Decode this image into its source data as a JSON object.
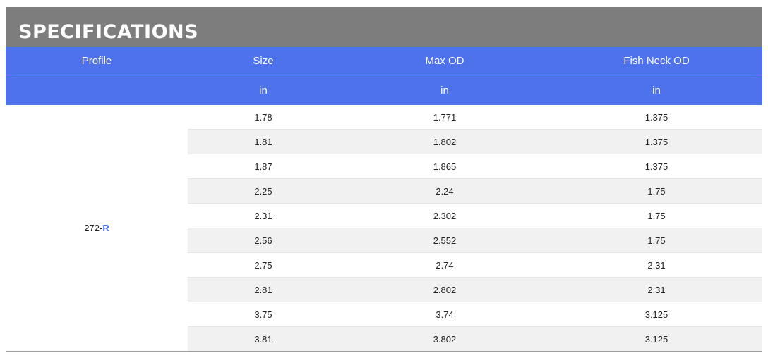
{
  "section": {
    "title": "SPECIFICATIONS"
  },
  "columns": [
    "Profile",
    "Size",
    "Max OD",
    "Fish Neck OD"
  ],
  "units": [
    "",
    "in",
    "in",
    "in"
  ],
  "profile": {
    "prefix": "272-",
    "suffix": "R"
  },
  "rows": [
    [
      "1.78",
      "1.771",
      "1.375"
    ],
    [
      "1.81",
      "1.802",
      "1.375"
    ],
    [
      "1.87",
      "1.865",
      "1.375"
    ],
    [
      "2.25",
      "2.24",
      "1.75"
    ],
    [
      "2.31",
      "2.302",
      "1.75"
    ],
    [
      "2.56",
      "2.552",
      "1.75"
    ],
    [
      "2.75",
      "2.74",
      "2.31"
    ],
    [
      "2.81",
      "2.802",
      "2.31"
    ],
    [
      "3.75",
      "3.74",
      "3.125"
    ],
    [
      "3.81",
      "3.802",
      "3.125"
    ]
  ],
  "colors": {
    "header_bg": "#4e72ec",
    "title_bg": "#7d7d7d",
    "alt_row": "#f1f1f1",
    "accent": "#4e72ec"
  }
}
